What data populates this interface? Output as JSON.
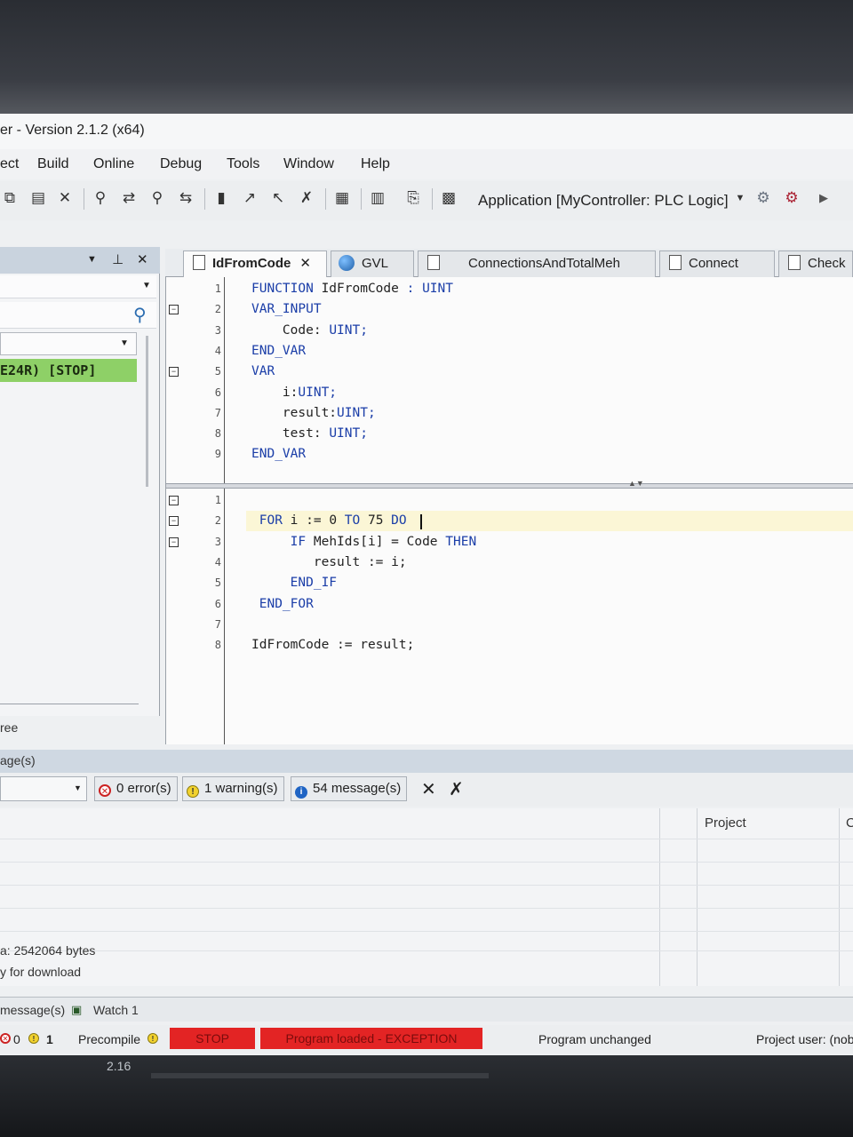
{
  "window": {
    "title": "er - Version 2.1.2 (x64)"
  },
  "menu": [
    "ect",
    "Build",
    "Online",
    "Debug",
    "Tools",
    "Window",
    "Help"
  ],
  "toolbar": {
    "application": "Application [MyController: PLC Logic]",
    "icons": [
      "copy-icon",
      "paste-icon",
      "delete-icon",
      "find-icon",
      "replace-icon",
      "find-in-project-icon",
      "replace-in-project-icon",
      "bookmark-icon",
      "next-bookmark-icon",
      "prev-bookmark-icon",
      "clear-bookmarks-icon",
      "clipboard-icon",
      "build-icon",
      "export-icon",
      "calendar-icon",
      "login-icon",
      "logout-icon",
      "run-icon"
    ]
  },
  "left_panel": {
    "device": "E24R) [STOP]",
    "tree_label": "ree"
  },
  "tabs": [
    {
      "label": "IdFromCode",
      "active": true,
      "icon": "document-icon"
    },
    {
      "label": "GVL",
      "active": false,
      "icon": "globe-icon"
    },
    {
      "label": "ConnectionsAndTotalMeh",
      "active": false,
      "icon": "document-icon"
    },
    {
      "label": "Connect",
      "active": false,
      "icon": "document-icon"
    },
    {
      "label": "Check",
      "active": false,
      "icon": "document-icon"
    }
  ],
  "declaration": [
    {
      "n": "1",
      "tokens": [
        [
          "kw",
          "FUNCTION"
        ],
        [
          "tx",
          " IdFromCode "
        ],
        [
          "kw",
          ": UINT"
        ]
      ]
    },
    {
      "n": "2",
      "tokens": [
        [
          "kw",
          "VAR_INPUT"
        ]
      ]
    },
    {
      "n": "3",
      "tokens": [
        [
          "tx",
          "    Code: "
        ],
        [
          "kw",
          "UINT;"
        ]
      ]
    },
    {
      "n": "4",
      "tokens": [
        [
          "kw",
          "END_VAR"
        ]
      ]
    },
    {
      "n": "5",
      "tokens": [
        [
          "kw",
          "VAR"
        ]
      ]
    },
    {
      "n": "6",
      "tokens": [
        [
          "tx",
          "    i:"
        ],
        [
          "kw",
          "UINT;"
        ]
      ]
    },
    {
      "n": "7",
      "tokens": [
        [
          "tx",
          "    result:"
        ],
        [
          "kw",
          "UINT;"
        ]
      ]
    },
    {
      "n": "8",
      "tokens": [
        [
          "tx",
          "    test: "
        ],
        [
          "kw",
          "UINT;"
        ]
      ]
    },
    {
      "n": "9",
      "tokens": [
        [
          "kw",
          "END_VAR"
        ]
      ]
    }
  ],
  "implementation": [
    {
      "n": "1",
      "tokens": [
        [
          "tx",
          ""
        ]
      ]
    },
    {
      "n": "2",
      "tokens": [
        [
          "tx",
          " "
        ],
        [
          "kw",
          "FOR"
        ],
        [
          "tx",
          " i := 0 "
        ],
        [
          "kw",
          "TO"
        ],
        [
          "tx",
          " 75 "
        ],
        [
          "kw",
          "DO"
        ]
      ]
    },
    {
      "n": "3",
      "tokens": [
        [
          "tx",
          "     "
        ],
        [
          "kw",
          "IF"
        ],
        [
          "tx",
          " MehIds[i] = Code "
        ],
        [
          "kw",
          "THEN"
        ]
      ]
    },
    {
      "n": "4",
      "tokens": [
        [
          "tx",
          "        result := i;"
        ]
      ]
    },
    {
      "n": "5",
      "tokens": [
        [
          "tx",
          "     "
        ],
        [
          "kw",
          "END_IF"
        ]
      ]
    },
    {
      "n": "6",
      "tokens": [
        [
          "tx",
          " "
        ],
        [
          "kw",
          "END_FOR"
        ]
      ]
    },
    {
      "n": "7",
      "tokens": [
        [
          "tx",
          ""
        ]
      ]
    },
    {
      "n": "8",
      "tokens": [
        [
          "tx",
          "IdFromCode := result;"
        ]
      ]
    }
  ],
  "messages": {
    "header": "age(s)",
    "errors": "0 error(s)",
    "warnings": "1 warning(s)",
    "infos": "54 message(s)",
    "col_project": "Project",
    "col_c": "C",
    "line1": "a: 2542064 bytes",
    "line2": "y for download"
  },
  "bottom_tabs": {
    "messages": "message(s)",
    "watch": "Watch 1"
  },
  "status": {
    "err_count": "0",
    "warn_count": "1",
    "precompile": "Precompile",
    "stop": "STOP",
    "program_loaded": "Program loaded - EXCEPTION",
    "program_unchanged": "Program unchanged",
    "project_user": "Project user: (nob"
  },
  "bezel": {
    "version": "2.16"
  }
}
